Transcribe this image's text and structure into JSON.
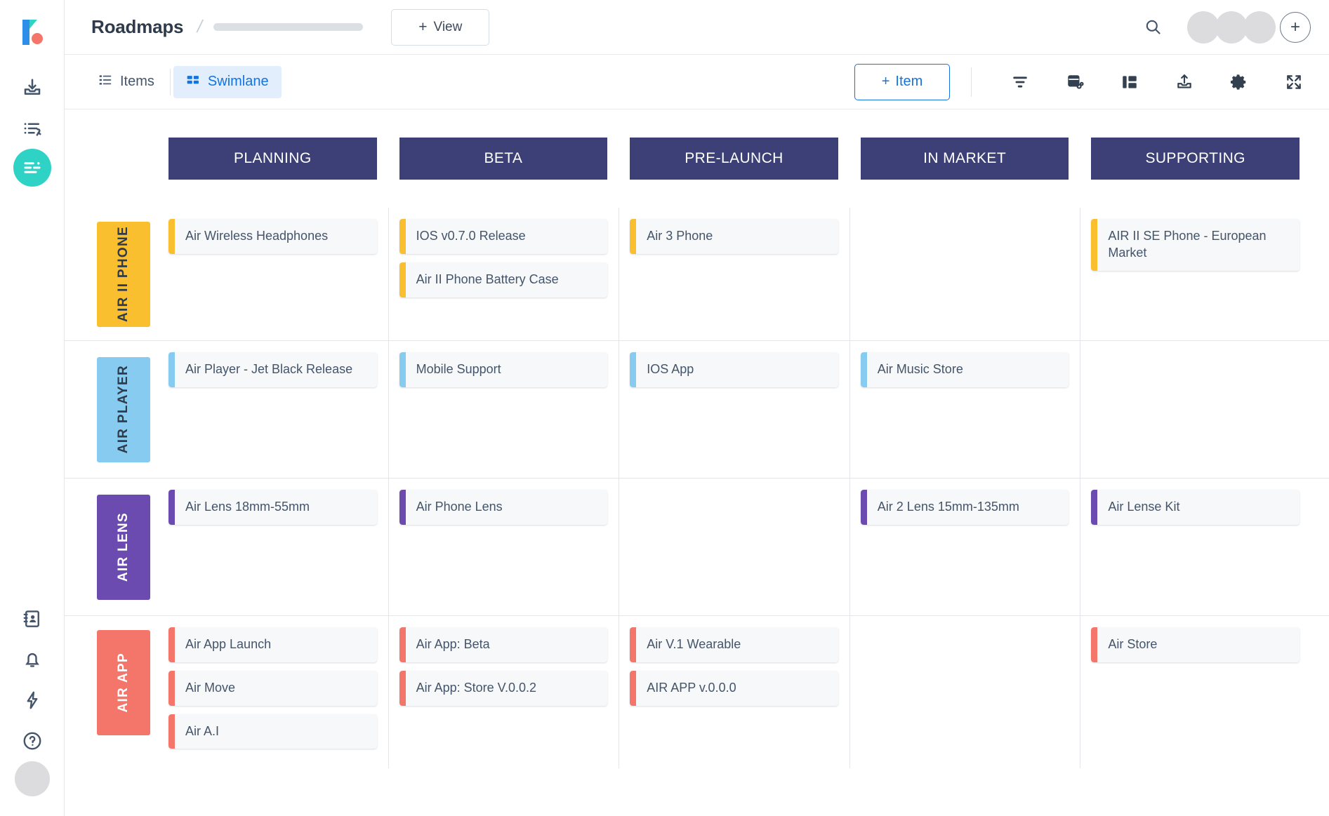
{
  "rail": {
    "logo": "kanban-logo",
    "items": [
      {
        "name": "inbox-download-icon",
        "label": "Inbox",
        "active": false
      },
      {
        "name": "task-list-icon",
        "label": "Tasks",
        "active": false
      },
      {
        "name": "roadmap-icon",
        "label": "Roadmaps",
        "active": true
      }
    ],
    "bottom_items": [
      {
        "name": "contacts-icon",
        "label": "Contacts"
      },
      {
        "name": "bell-icon",
        "label": "Notifications"
      },
      {
        "name": "bolt-icon",
        "label": "Automations"
      },
      {
        "name": "help-icon",
        "label": "Help"
      }
    ],
    "avatar": "user-avatar"
  },
  "header": {
    "title": "Roadmaps",
    "breadcrumb_separator": "/",
    "view_button": {
      "plus": "+",
      "label": "View"
    },
    "search_icon": "search-icon",
    "avatar_count": 3,
    "add_member": "+"
  },
  "toolbar": {
    "tabs": [
      {
        "label": "Items",
        "icon": "list-icon",
        "active": false
      },
      {
        "label": "Swimlane",
        "icon": "swimlane-icon",
        "active": true
      }
    ],
    "item_button": {
      "plus": "+",
      "label": "Item"
    },
    "icons": [
      {
        "name": "filter-icon"
      },
      {
        "name": "card-link-icon"
      },
      {
        "name": "layout-panel-icon"
      },
      {
        "name": "upload-icon"
      },
      {
        "name": "gear-icon"
      },
      {
        "name": "fullscreen-icon"
      }
    ]
  },
  "board": {
    "columns": [
      "PLANNING",
      "BETA",
      "PRE-LAUNCH",
      "IN MARKET",
      "SUPPORTING"
    ],
    "column_header_color": "#3d3f77",
    "lanes": [
      {
        "label": "AIR II PHONE",
        "color": "#f9bf2f",
        "text_color": "#2f3b4a",
        "accent": "c-yellow",
        "cells": [
          [
            "Air Wireless Headphones"
          ],
          [
            "IOS v0.7.0 Release",
            "Air II Phone Battery Case"
          ],
          [
            "Air 3 Phone"
          ],
          [],
          [
            "AIR II SE Phone - European Market"
          ]
        ]
      },
      {
        "label": "AIR PLAYER",
        "color": "#87ccf0",
        "text_color": "#2f3b4a",
        "accent": "c-blue",
        "cells": [
          [
            "Air Player - Jet Black Release"
          ],
          [
            "Mobile Support"
          ],
          [
            "IOS App"
          ],
          [
            "Air Music Store"
          ],
          []
        ]
      },
      {
        "label": "AIR LENS",
        "color": "#6c4bb0",
        "text_color": "#ffffff",
        "accent": "c-purple",
        "cells": [
          [
            "Air Lens 18mm-55mm"
          ],
          [
            "Air Phone Lens"
          ],
          [],
          [
            "Air 2 Lens 15mm-135mm"
          ],
          [
            "Air Lense Kit"
          ]
        ]
      },
      {
        "label": "AIR APP",
        "color": "#f4766a",
        "text_color": "#ffffff",
        "accent": "c-red",
        "cells": [
          [
            "Air App Launch",
            "Air Move",
            "Air A.I"
          ],
          [
            "Air App: Beta",
            "Air App: Store V.0.0.2"
          ],
          [
            "Air V.1 Wearable",
            "AIR APP v.0.0.0"
          ],
          [],
          [
            "Air Store"
          ]
        ]
      }
    ]
  }
}
